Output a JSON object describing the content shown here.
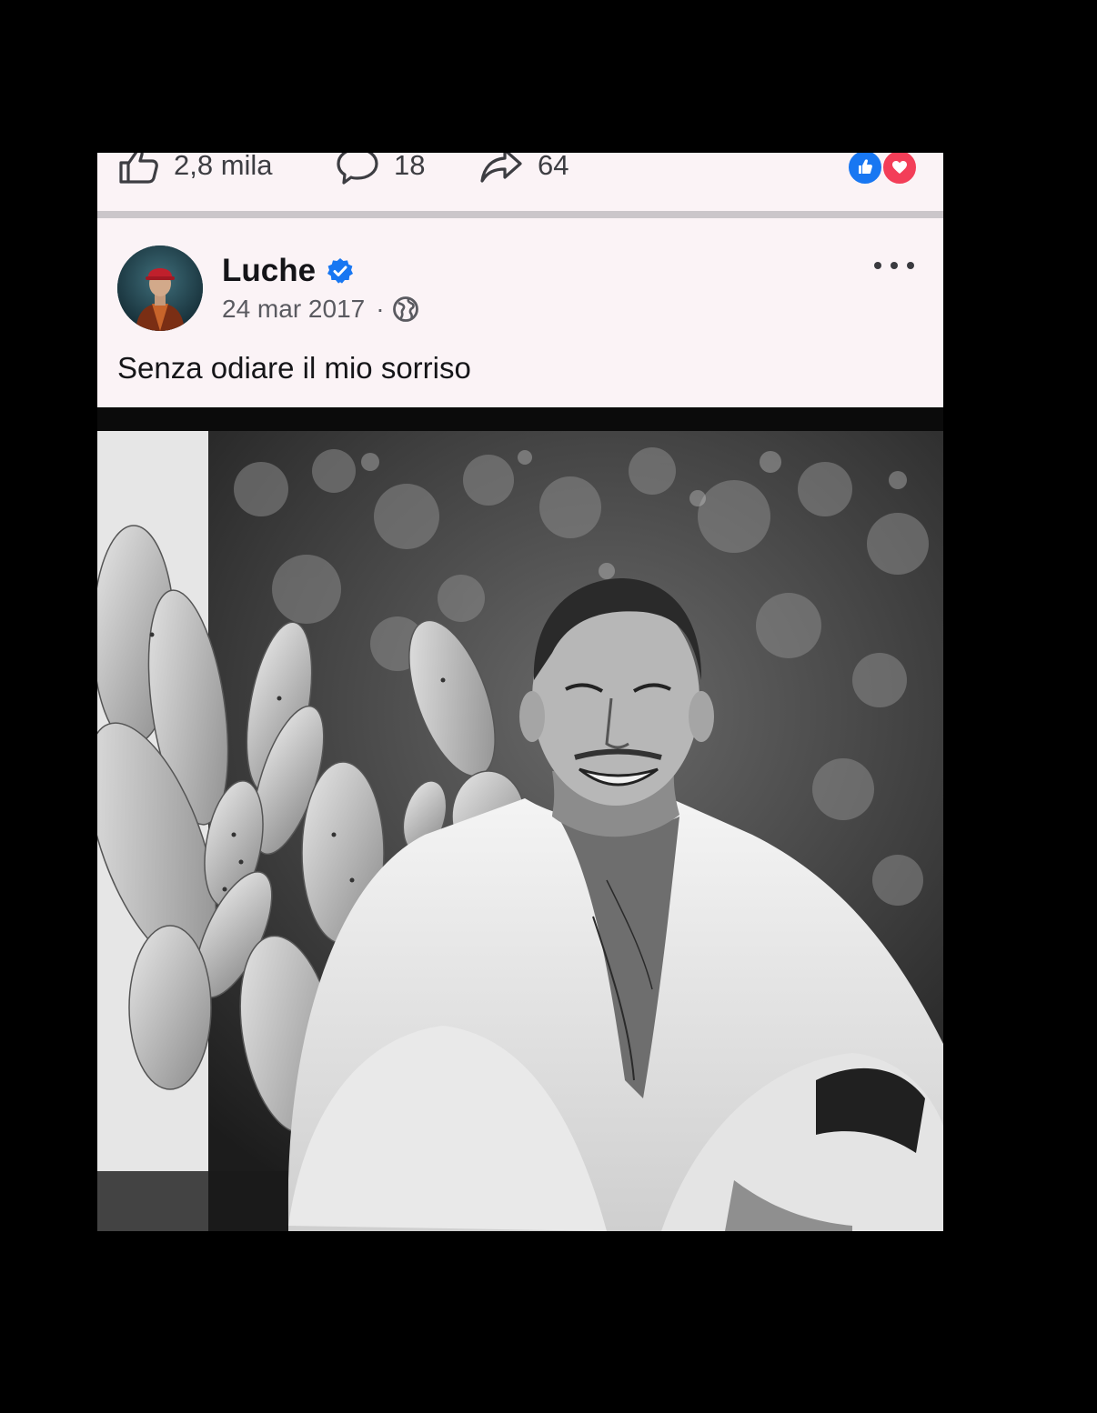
{
  "previous_post": {
    "likes": "2,8 mila",
    "comments": "18",
    "shares": "64",
    "reaction_icons": [
      "like-reaction-icon",
      "love-reaction-icon"
    ]
  },
  "post": {
    "author": "Luche",
    "verified": true,
    "date": "24 mar 2017",
    "separator": "·",
    "audience_icon": "globe-icon",
    "text": "Senza odiare il mio sorriso",
    "photo_tone": "black-and-white"
  },
  "colors": {
    "card_background": "#fbf3f6",
    "verified_blue": "#1877f2",
    "love_red": "#f33e58",
    "outer_background": "#000000"
  }
}
